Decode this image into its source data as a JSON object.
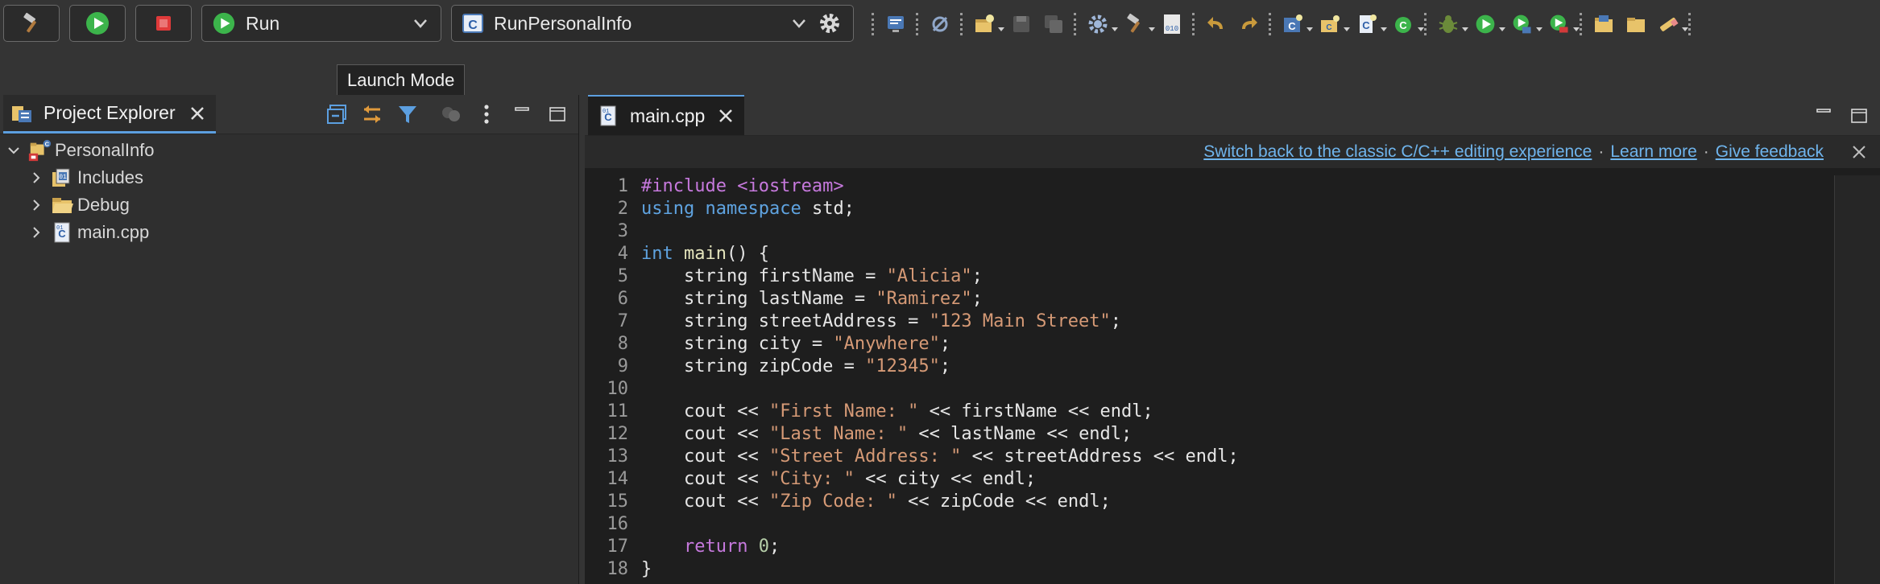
{
  "toolbar": {
    "run_mode": "Run",
    "launch_config": "RunPersonalInfo"
  },
  "tooltip": {
    "text": "Launch Mode"
  },
  "project_explorer": {
    "title": "Project Explorer",
    "tree": [
      {
        "label": "PersonalInfo",
        "expanded": true,
        "icon": "project-icon"
      },
      {
        "label": "Includes",
        "icon": "includes-icon"
      },
      {
        "label": "Debug",
        "icon": "folder-icon"
      },
      {
        "label": "main.cpp",
        "icon": "cpp-file-icon"
      }
    ]
  },
  "editor": {
    "tab_label": "main.cpp",
    "banner": {
      "switch_link": "Switch back to the classic C/C++ editing experience",
      "separator": "·",
      "learn_more": "Learn more",
      "feedback": "Give feedback"
    },
    "lines": [
      {
        "n": "1",
        "tokens": [
          [
            "pp",
            "#include <iostream>"
          ]
        ]
      },
      {
        "n": "2",
        "tokens": [
          [
            "kw",
            "using "
          ],
          [
            "kw",
            "namespace"
          ],
          [
            "t",
            " std;"
          ]
        ]
      },
      {
        "n": "3",
        "tokens": []
      },
      {
        "n": "4",
        "tokens": [
          [
            "kw",
            "int "
          ],
          [
            "fn",
            "main"
          ],
          [
            "t",
            "() {"
          ]
        ]
      },
      {
        "n": "5",
        "tokens": [
          [
            "t",
            "    string firstName = "
          ],
          [
            "str",
            "\"Alicia\""
          ],
          [
            "t",
            ";"
          ]
        ]
      },
      {
        "n": "6",
        "tokens": [
          [
            "t",
            "    string lastName = "
          ],
          [
            "str",
            "\"Ramirez\""
          ],
          [
            "t",
            ";"
          ]
        ]
      },
      {
        "n": "7",
        "tokens": [
          [
            "t",
            "    string streetAddress = "
          ],
          [
            "str",
            "\"123 Main Street\""
          ],
          [
            "t",
            ";"
          ]
        ]
      },
      {
        "n": "8",
        "tokens": [
          [
            "t",
            "    string city = "
          ],
          [
            "str",
            "\"Anywhere\""
          ],
          [
            "t",
            ";"
          ]
        ]
      },
      {
        "n": "9",
        "tokens": [
          [
            "t",
            "    string zipCode = "
          ],
          [
            "str",
            "\"12345\""
          ],
          [
            "t",
            ";"
          ]
        ]
      },
      {
        "n": "10",
        "tokens": []
      },
      {
        "n": "11",
        "tokens": [
          [
            "t",
            "    cout << "
          ],
          [
            "str",
            "\"First Name: \""
          ],
          [
            "t",
            " << firstName << endl;"
          ]
        ]
      },
      {
        "n": "12",
        "tokens": [
          [
            "t",
            "    cout << "
          ],
          [
            "str",
            "\"Last Name: \""
          ],
          [
            "t",
            " << lastName << endl;"
          ]
        ]
      },
      {
        "n": "13",
        "tokens": [
          [
            "t",
            "    cout << "
          ],
          [
            "str",
            "\"Street Address: \""
          ],
          [
            "t",
            " << streetAddress << endl;"
          ]
        ]
      },
      {
        "n": "14",
        "tokens": [
          [
            "t",
            "    cout << "
          ],
          [
            "str",
            "\"City: \""
          ],
          [
            "t",
            " << city << endl;"
          ]
        ]
      },
      {
        "n": "15",
        "tokens": [
          [
            "t",
            "    cout << "
          ],
          [
            "str",
            "\"Zip Code: \""
          ],
          [
            "t",
            " << zipCode << endl;"
          ]
        ]
      },
      {
        "n": "16",
        "tokens": []
      },
      {
        "n": "17",
        "tokens": [
          [
            "t",
            "    "
          ],
          [
            "ret",
            "return "
          ],
          [
            "num",
            "0"
          ],
          [
            "t",
            ";"
          ]
        ]
      },
      {
        "n": "18",
        "tokens": [
          [
            "t",
            "}"
          ]
        ]
      }
    ]
  },
  "colors": {
    "accent": "#5c9fe0",
    "keyword": "#5fa3e0",
    "preprocessor": "#c679dd",
    "string": "#d69a76",
    "link": "#6fb4ec",
    "run_green": "#3cb44b",
    "stop_red": "#e03a3a"
  }
}
